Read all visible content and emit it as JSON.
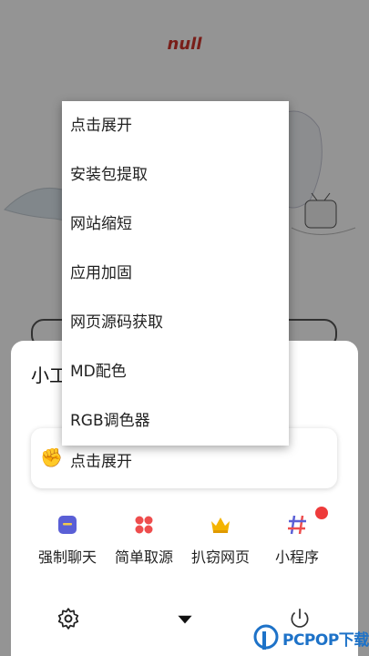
{
  "app": {
    "brand": "null"
  },
  "sheet": {
    "title": "小工"
  },
  "expand_card": {
    "label": "点击展开",
    "icon": "hand-rock-icon"
  },
  "tools": [
    {
      "label": "强制聊天",
      "icon": "chat-box-icon",
      "color": "#5a5fd6"
    },
    {
      "label": "简单取源",
      "icon": "flower-icon",
      "color": "#ee4d4d"
    },
    {
      "label": "扒窃网页",
      "icon": "crown-icon",
      "color": "#f4b400"
    },
    {
      "label": "小程序",
      "icon": "hashtag-icon",
      "color": "#5a5fd6",
      "badge": true
    }
  ],
  "bottom_bar": {
    "left_icon": "gear-icon",
    "center_icon": "caret-down-icon",
    "right_icon": "power-icon"
  },
  "menu": {
    "items": [
      "点击展开",
      "安装包提取",
      "网站缩短",
      "应用加固",
      "网页源码获取",
      "MD配色",
      "RGB调色器"
    ]
  },
  "watermark": {
    "text": "PCPOP下载"
  },
  "colors": {
    "accent": "#d0342c",
    "badge": "#ee3b3b",
    "watermark": "#1d72c8"
  }
}
